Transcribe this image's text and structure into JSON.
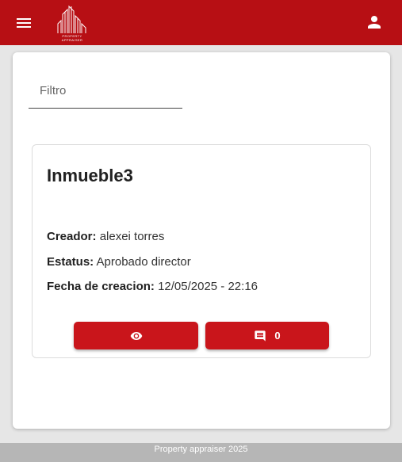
{
  "header": {
    "logo_text": "PROPERTY APPRAISER",
    "menu_icon": "menu-icon",
    "account_icon": "person-icon",
    "color": "#b70f14"
  },
  "filter": {
    "placeholder": "Filtro",
    "value": ""
  },
  "card": {
    "title": "Inmueble3",
    "creator_label": "Creador:",
    "creator_value": "alexei torres",
    "status_label": "Estatus:",
    "status_value": "Aprobado director",
    "date_label": "Fecha de creacion:",
    "date_value": "12/05/2025 - 22:16",
    "view_icon": "eye-icon",
    "comments_icon": "comment-icon",
    "comments_count": "0",
    "button_color": "#c9151b"
  },
  "footer": {
    "text": "Property appraiser 2025"
  }
}
